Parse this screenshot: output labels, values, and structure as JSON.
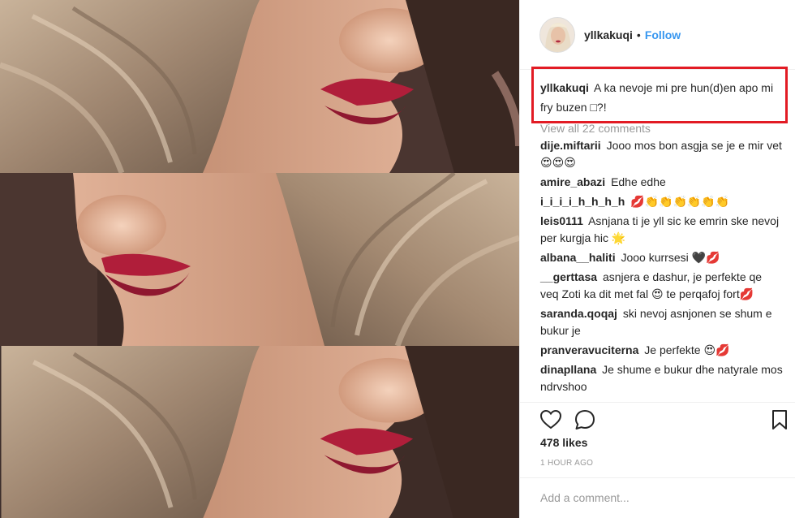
{
  "post": {
    "username": "yllkakuqi",
    "separator": "•",
    "follow_label": "Follow",
    "caption_username": "yllkakuqi",
    "caption_text": "A ka nevoje mi pre hun(d)en apo mi fry buzen □?!",
    "view_all_comments": "View all 22 comments",
    "likes": "478 likes",
    "time": "1 HOUR AGO",
    "add_comment_placeholder": "Add a comment..."
  },
  "comments": [
    {
      "user": "dije.miftarii",
      "text": "Jooo mos bon asgja se je e mir vet 😍😍😍"
    },
    {
      "user": "amire_abazi",
      "text": "Edhe edhe"
    },
    {
      "user": "i_i_i_i_h_h_h_h",
      "text": "💋👏👏👏👏👏👏"
    },
    {
      "user": "leis0111",
      "text": "Asnjana ti je yll sic ke emrin ske nevoj per kurgja hic 🌟"
    },
    {
      "user": "albana__haliti",
      "text": "Jooo kurrsesi 🖤💋"
    },
    {
      "user": "__gerttasa",
      "text": "asnjera e dashur, je perfekte qe veq Zoti ka dit met fal 😍 te perqafoj fort💋"
    },
    {
      "user": "saranda.qoqaj",
      "text": "ski nevoj asnjonen se shum e bukur je"
    },
    {
      "user": "pranveravuciterna",
      "text": "Je perfekte 😍💋"
    },
    {
      "user": "dinapllana",
      "text": "Je shume e bukur dhe natyrale mos ndrvshoo"
    }
  ],
  "colors": {
    "accent": "#3897f0",
    "highlight_box": "#e21b24",
    "muted_text": "#999999",
    "lips": "#9e1f36"
  },
  "icons": [
    "heart-icon",
    "comment-icon",
    "bookmark-icon"
  ]
}
